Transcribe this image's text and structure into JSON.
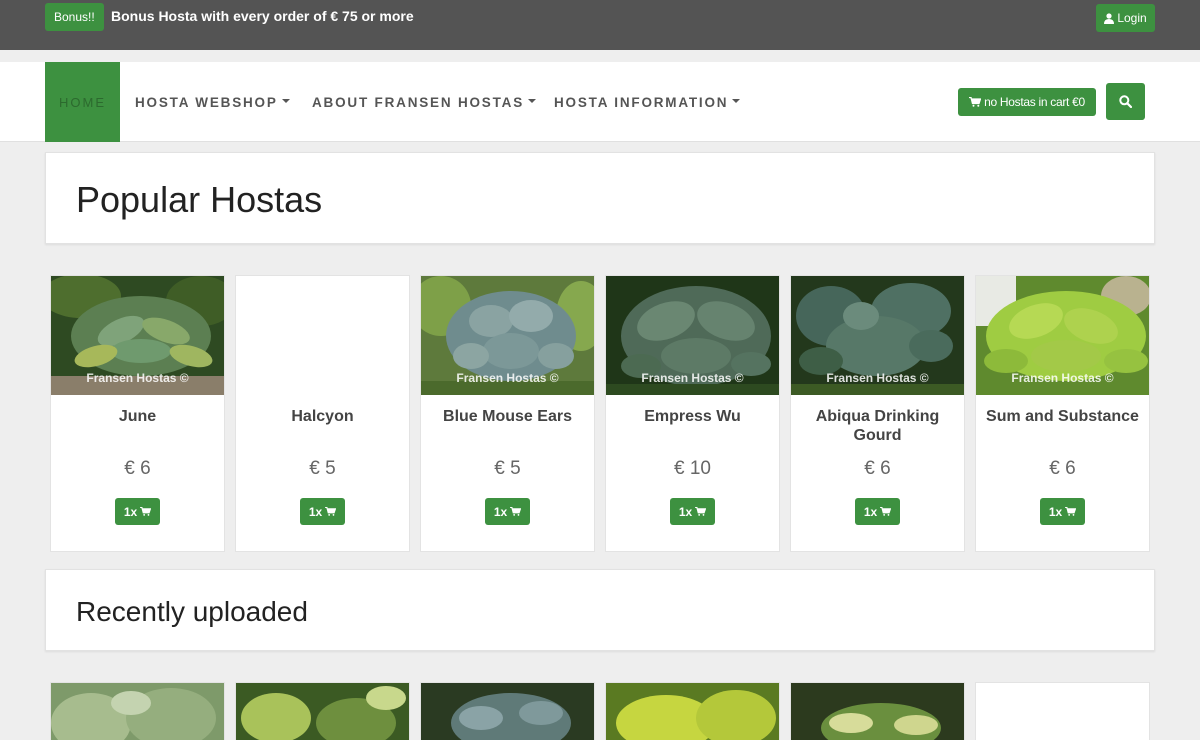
{
  "topbar": {
    "bonus_badge": "Bonus!!",
    "bonus_text": "Bonus Hosta with every order of € 75 or more",
    "login_label": "Login"
  },
  "nav": {
    "home": "HOME",
    "webshop": "HOSTA WEBSHOP",
    "about": "ABOUT FRANSEN HOSTAS",
    "information": "HOSTA INFORMATION",
    "cart_label": "no Hostas in cart €0"
  },
  "sections": {
    "popular_title": "Popular Hostas",
    "recent_title": "Recently uploaded"
  },
  "popular": [
    {
      "name": "June",
      "price": "€ 6",
      "button": "1x",
      "watermark": "Fransen Hostas ©",
      "image": "hosta-june"
    },
    {
      "name": "Halcyon",
      "price": "€ 5",
      "button": "1x",
      "watermark": "",
      "image": "none"
    },
    {
      "name": "Blue Mouse Ears",
      "price": "€ 5",
      "button": "1x",
      "watermark": "Fransen Hostas ©",
      "image": "hosta-blue-mouse-ears"
    },
    {
      "name": "Empress Wu",
      "price": "€ 10",
      "button": "1x",
      "watermark": "Fransen Hostas ©",
      "image": "hosta-empress-wu"
    },
    {
      "name": "Abiqua Drinking Gourd",
      "price": "€ 6",
      "button": "1x",
      "watermark": "Fransen Hostas ©",
      "image": "hosta-abiqua-drinking-gourd"
    },
    {
      "name": "Sum and Substance",
      "price": "€ 6",
      "button": "1x",
      "watermark": "Fransen Hostas ©",
      "image": "hosta-sum-and-substance"
    }
  ],
  "colors": {
    "accent": "#3d9140",
    "topbar": "#545454",
    "background": "#eeeeee"
  }
}
